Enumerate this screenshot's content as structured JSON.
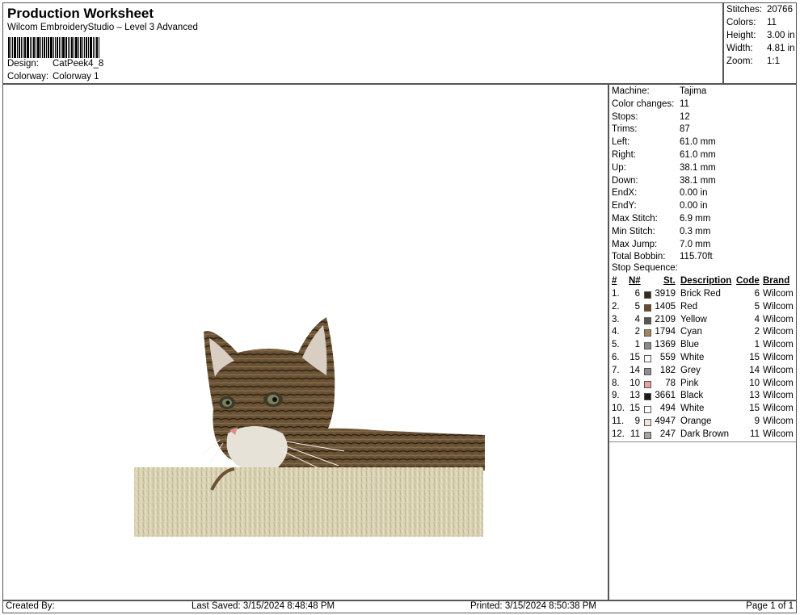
{
  "header": {
    "title": "Production Worksheet",
    "subtitle": "Wilcom EmbroideryStudio – Level 3 Advanced",
    "design_label": "Design:",
    "design_value": "CatPeek4_8",
    "colorway_label": "Colorway:",
    "colorway_value": "Colorway 1"
  },
  "stats": [
    {
      "label": "Stitches:",
      "value": "20766"
    },
    {
      "label": "Colors:",
      "value": "11"
    },
    {
      "label": "Height:",
      "value": "3.00 in"
    },
    {
      "label": "Width:",
      "value": "4.81 in"
    },
    {
      "label": "Zoom:",
      "value": "1:1"
    }
  ],
  "machine_info": [
    {
      "label": "Machine:",
      "value": "Tajima"
    },
    {
      "label": "Color changes:",
      "value": "11"
    },
    {
      "label": "Stops:",
      "value": "12"
    },
    {
      "label": "Trims:",
      "value": "87"
    },
    {
      "label": "Left:",
      "value": "61.0 mm"
    },
    {
      "label": "Right:",
      "value": "61.0 mm"
    },
    {
      "label": "Up:",
      "value": "38.1 mm"
    },
    {
      "label": "Down:",
      "value": "38.1 mm"
    },
    {
      "label": "EndX:",
      "value": "0.00 in"
    },
    {
      "label": "EndY:",
      "value": "0.00 in"
    },
    {
      "label": "Max Stitch:",
      "value": "6.9 mm"
    },
    {
      "label": "Min Stitch:",
      "value": "0.3 mm"
    },
    {
      "label": "Max Jump:",
      "value": "7.0 mm"
    },
    {
      "label": "Total Bobbin:",
      "value": "115.70ft"
    }
  ],
  "stop_sequence": {
    "title": "Stop Sequence:",
    "headers": {
      "idx": "#",
      "n": "N#",
      "st": "St.",
      "desc": "Description",
      "code": "Code",
      "brand": "Brand"
    },
    "rows": [
      {
        "idx": "1.",
        "n": "6",
        "color": "#3a2a1c",
        "st": "3919",
        "desc": "Brick Red",
        "code": "6",
        "brand": "Wilcom"
      },
      {
        "idx": "2.",
        "n": "5",
        "color": "#6b4a2a",
        "st": "1405",
        "desc": "Red",
        "code": "5",
        "brand": "Wilcom"
      },
      {
        "idx": "3.",
        "n": "4",
        "color": "#5a5650",
        "st": "2109",
        "desc": "Yellow",
        "code": "4",
        "brand": "Wilcom"
      },
      {
        "idx": "4.",
        "n": "2",
        "color": "#a0845e",
        "st": "1794",
        "desc": "Cyan",
        "code": "2",
        "brand": "Wilcom"
      },
      {
        "idx": "5.",
        "n": "1",
        "color": "#8a8a8a",
        "st": "1369",
        "desc": "Blue",
        "code": "1",
        "brand": "Wilcom"
      },
      {
        "idx": "6.",
        "n": "15",
        "color": "#ffffff",
        "st": "559",
        "desc": "White",
        "code": "15",
        "brand": "Wilcom"
      },
      {
        "idx": "7.",
        "n": "14",
        "color": "#8e8e8e",
        "st": "182",
        "desc": "Grey",
        "code": "14",
        "brand": "Wilcom"
      },
      {
        "idx": "8.",
        "n": "10",
        "color": "#e8a0a0",
        "st": "78",
        "desc": "Pink",
        "code": "10",
        "brand": "Wilcom"
      },
      {
        "idx": "9.",
        "n": "13",
        "color": "#1a1a1a",
        "st": "3661",
        "desc": "Black",
        "code": "13",
        "brand": "Wilcom"
      },
      {
        "idx": "10.",
        "n": "15",
        "color": "#ffffff",
        "st": "494",
        "desc": "White",
        "code": "15",
        "brand": "Wilcom"
      },
      {
        "idx": "11.",
        "n": "9",
        "color": "#f4e4d8",
        "st": "4947",
        "desc": "Orange",
        "code": "9",
        "brand": "Wilcom"
      },
      {
        "idx": "12.",
        "n": "11",
        "color": "#a8a49e",
        "st": "247",
        "desc": "Dark Brown",
        "code": "11",
        "brand": "Wilcom"
      }
    ]
  },
  "footer": {
    "created_by": "Created By:",
    "last_saved": "Last Saved: 3/15/2024 8:48:48 PM",
    "printed": "Printed: 3/15/2024 8:50:38 PM",
    "page": "Page 1 of 1"
  }
}
